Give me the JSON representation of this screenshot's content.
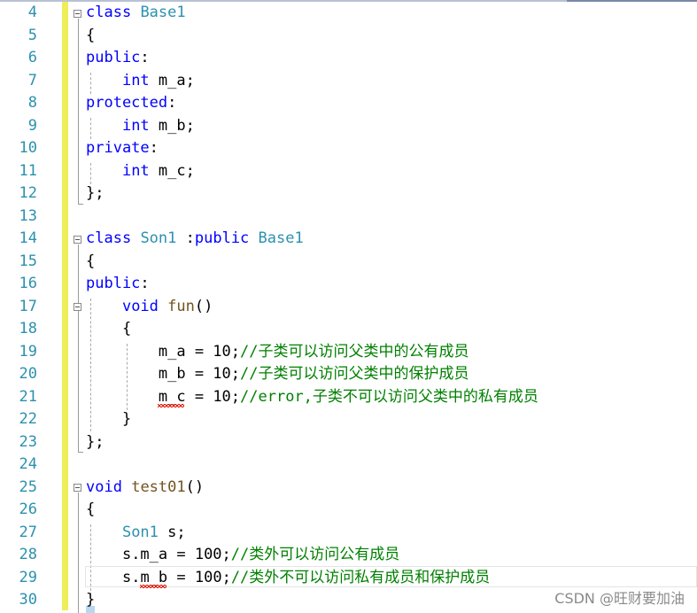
{
  "editor": {
    "line_numbers": [
      "4",
      "5",
      "6",
      "7",
      "8",
      "9",
      "10",
      "11",
      "12",
      "13",
      "14",
      "15",
      "16",
      "17",
      "18",
      "19",
      "20",
      "21",
      "22",
      "23",
      "24",
      "25",
      "26",
      "27",
      "28",
      "29",
      "30"
    ],
    "lines": {
      "l4": {
        "kw": "class",
        "name": "Base1"
      },
      "l5": {
        "text": "{"
      },
      "l6": {
        "kw": "public",
        "punct": ":"
      },
      "l7": {
        "kw": "int",
        "rest": " m_a;"
      },
      "l8": {
        "kw": "protected",
        "punct": ":"
      },
      "l9": {
        "kw": "int",
        "rest": " m_b;"
      },
      "l10": {
        "kw": "private",
        "punct": ":"
      },
      "l11": {
        "kw": "int",
        "rest": " m_c;"
      },
      "l12": {
        "text": "};"
      },
      "l14": {
        "kw": "class",
        "name": "Son1",
        "mid": " :",
        "kw2": "public",
        "name2": "Base1"
      },
      "l15": {
        "text": "{"
      },
      "l16": {
        "kw": "public",
        "punct": ":"
      },
      "l17": {
        "kw": "void",
        "fn": "fun",
        "rest": "()"
      },
      "l18": {
        "text": "{"
      },
      "l19": {
        "code": "m_a = 10;",
        "comment": "//子类可以访问父类中的公有成员"
      },
      "l20": {
        "code": "m_b = 10;",
        "comment": "//子类可以访问父类中的保护成员"
      },
      "l21": {
        "code_a": "m_c",
        "code_b": " = 10;",
        "comment": "//error,子类不可以访问父类中的私有成员"
      },
      "l22": {
        "text": "}"
      },
      "l23": {
        "text": "};"
      },
      "l25": {
        "kw": "void",
        "fn": "test01",
        "rest": "()"
      },
      "l26": {
        "text": "{"
      },
      "l27": {
        "ty": "Son1",
        "rest": " s;"
      },
      "l28": {
        "code": "s.m_a = 100;",
        "comment": "//类外可以访问公有成员"
      },
      "l29": {
        "code_a": "s.",
        "code_m": "m_b",
        "code_b": " = 100;",
        "comment": "//类外不可以访问私有成员和保护成员"
      },
      "l30": {
        "text": "}"
      }
    }
  },
  "watermark": "CSDN @旺财要加油",
  "colors": {
    "keyword": "#0000ff",
    "type": "#2b91af",
    "function": "#74531f",
    "comment": "#008000",
    "line_number": "#2b91af",
    "change_bar": "#eeee58"
  }
}
